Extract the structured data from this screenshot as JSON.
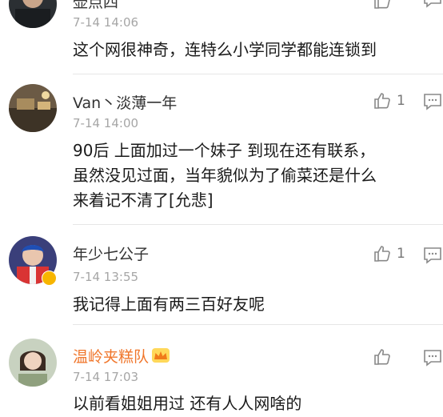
{
  "comments": [
    {
      "name": "壶点四",
      "time": "7-14 14:06",
      "text": [
        "这个网很神奇，连特么小学同学都能连锁到"
      ],
      "likes": ""
    },
    {
      "name": "Van丶淡薄一年",
      "time": "7-14 14:00",
      "text": [
        "90后  上面加过一个妹子   到现在还有联系，",
        "虽然没见过面，当年貌似为了偷菜还是什么",
        "来着记不清了[允悲]"
      ],
      "likes": "1"
    },
    {
      "name": "年少七公子",
      "time": "7-14 13:55",
      "text": [
        "我记得上面有两三百好友呢"
      ],
      "likes": "1"
    },
    {
      "name": "温岭夹糕队",
      "time": "7-14 17:03",
      "text": [
        "以前看姐姐用过 还有人人网啥的"
      ],
      "likes": ""
    }
  ],
  "colors": {
    "vip_name": "#f0762b",
    "timestamp": "#a6a6a6",
    "badge": "#f7b500"
  },
  "icons": {
    "like": "thumbs-up-icon",
    "reply": "comment-icon",
    "vip": "crown-icon",
    "verified": "verified-badge-icon"
  }
}
